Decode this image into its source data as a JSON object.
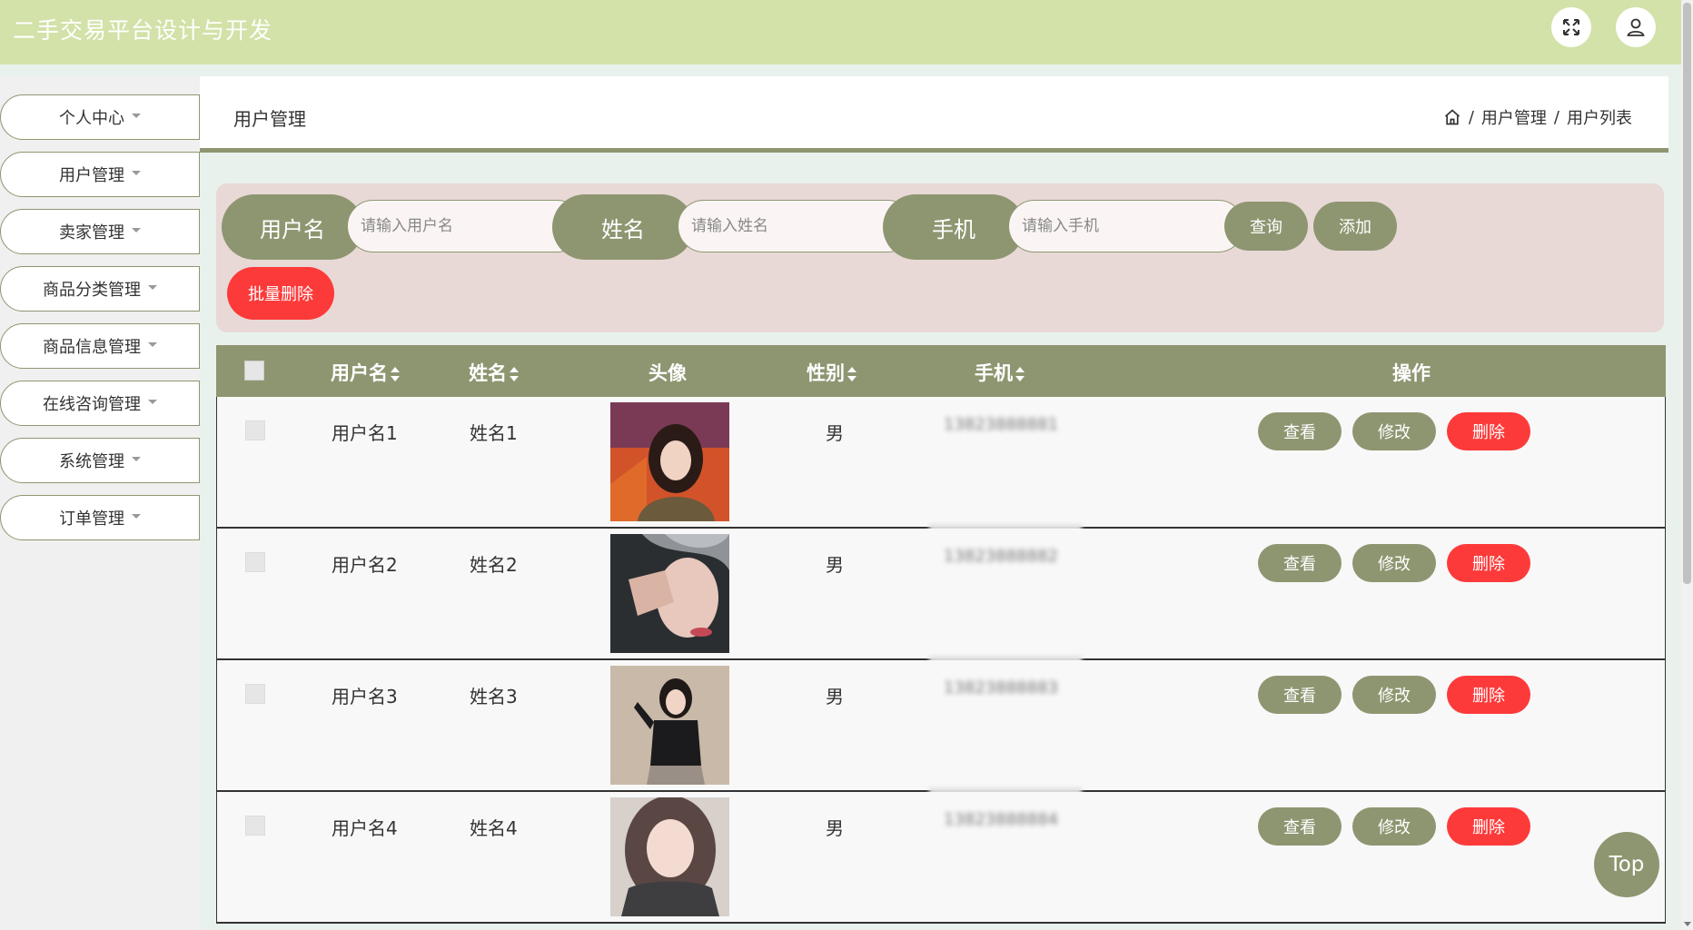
{
  "header": {
    "title": "二手交易平台设计与开发",
    "expand_icon": "expand-icon",
    "user_icon": "user-icon"
  },
  "sidebar": {
    "items": [
      {
        "label": "个人中心"
      },
      {
        "label": "用户管理"
      },
      {
        "label": "卖家管理"
      },
      {
        "label": "商品分类管理"
      },
      {
        "label": "商品信息管理"
      },
      {
        "label": "在线咨询管理"
      },
      {
        "label": "系统管理"
      },
      {
        "label": "订单管理"
      }
    ]
  },
  "page": {
    "title": "用户管理",
    "breadcrumb": [
      "用户管理",
      "用户列表"
    ],
    "breadcrumb_sep": "/"
  },
  "search": {
    "fields": [
      {
        "label": "用户名",
        "placeholder": "请输入用户名",
        "value": ""
      },
      {
        "label": "姓名",
        "placeholder": "请输入姓名",
        "value": ""
      },
      {
        "label": "手机",
        "placeholder": "请输入手机",
        "value": ""
      }
    ],
    "query_label": "查询",
    "add_label": "添加",
    "batch_delete_label": "批量删除"
  },
  "table": {
    "columns": [
      "用户名",
      "姓名",
      "头像",
      "性别",
      "手机",
      "操作"
    ],
    "rows": [
      {
        "username": "用户名1",
        "name": "姓名1",
        "gender": "男",
        "phone": "13823888881"
      },
      {
        "username": "用户名2",
        "name": "姓名2",
        "gender": "男",
        "phone": "13823888882"
      },
      {
        "username": "用户名3",
        "name": "姓名3",
        "gender": "男",
        "phone": "13823888883"
      },
      {
        "username": "用户名4",
        "name": "姓名4",
        "gender": "男",
        "phone": "13823888884"
      }
    ],
    "actions": {
      "view": "查看",
      "edit": "修改",
      "delete": "删除"
    }
  },
  "to_top_label": "Top",
  "colors": {
    "header_bg": "#d2e2a8",
    "accent": "#8e9671",
    "danger": "#fd3a3a",
    "search_panel_bg": "#e8d9d6"
  }
}
